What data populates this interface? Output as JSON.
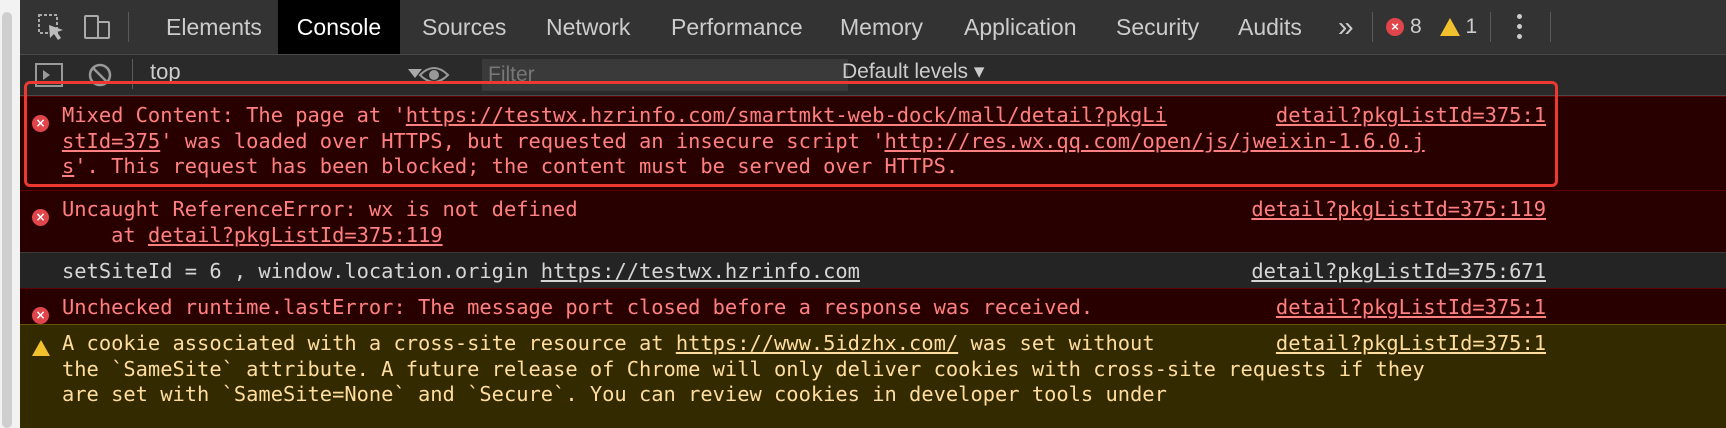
{
  "tabs": [
    {
      "label": "Elements",
      "active": false
    },
    {
      "label": "Console",
      "active": true
    },
    {
      "label": "Sources",
      "active": false
    },
    {
      "label": "Network",
      "active": false
    },
    {
      "label": "Performance",
      "active": false
    },
    {
      "label": "Memory",
      "active": false
    },
    {
      "label": "Application",
      "active": false
    },
    {
      "label": "Security",
      "active": false
    },
    {
      "label": "Audits",
      "active": false
    }
  ],
  "more_label": "»",
  "error_count": "8",
  "warning_count": "1",
  "toolbar": {
    "context": "top",
    "filter_placeholder": "Filter",
    "levels": "Default levels ▾"
  },
  "messages": [
    {
      "level": "error",
      "lines": [
        [
          "Mixed Content: The page at '",
          "https://testwx.hzrinfo.com/smartmkt-web-dock/mall/detail?pkgLi"
        ],
        [
          "stId=375",
          "' was loaded over HTTPS, but requested an insecure script '",
          "http://res.wx.qq.com/open/js/jweixin-1.6.0.j"
        ],
        [
          "s",
          "'. This request has been blocked; the content must be served over HTTPS."
        ]
      ],
      "source": "detail?pkgListId=375:1"
    },
    {
      "level": "error",
      "lines": [
        [
          "Uncaught ReferenceError: wx is not defined"
        ],
        [
          "    at ",
          "detail?pkgListId=375:119"
        ]
      ],
      "source": "detail?pkgListId=375:119"
    },
    {
      "level": "info",
      "lines": [
        [
          "setSiteId = 6 , window.location.origin ",
          "https://testwx.hzrinfo.com"
        ]
      ],
      "source": "detail?pkgListId=375:671"
    },
    {
      "level": "error",
      "lines": [
        [
          "Unchecked runtime.lastError: The message port closed before a response was received."
        ]
      ],
      "source": "detail?pkgListId=375:1"
    },
    {
      "level": "warning",
      "lines": [
        [
          "A cookie associated with a cross-site resource at ",
          "https://www.5idzhx.com/",
          " was set without"
        ],
        [
          "the `SameSite` attribute. A future release of Chrome will only deliver cookies with cross-site requests if they"
        ],
        [
          "are set with `SameSite=None` and `Secure`. You can review cookies in developer tools under"
        ]
      ],
      "source": "detail?pkgListId=375:1"
    }
  ]
}
